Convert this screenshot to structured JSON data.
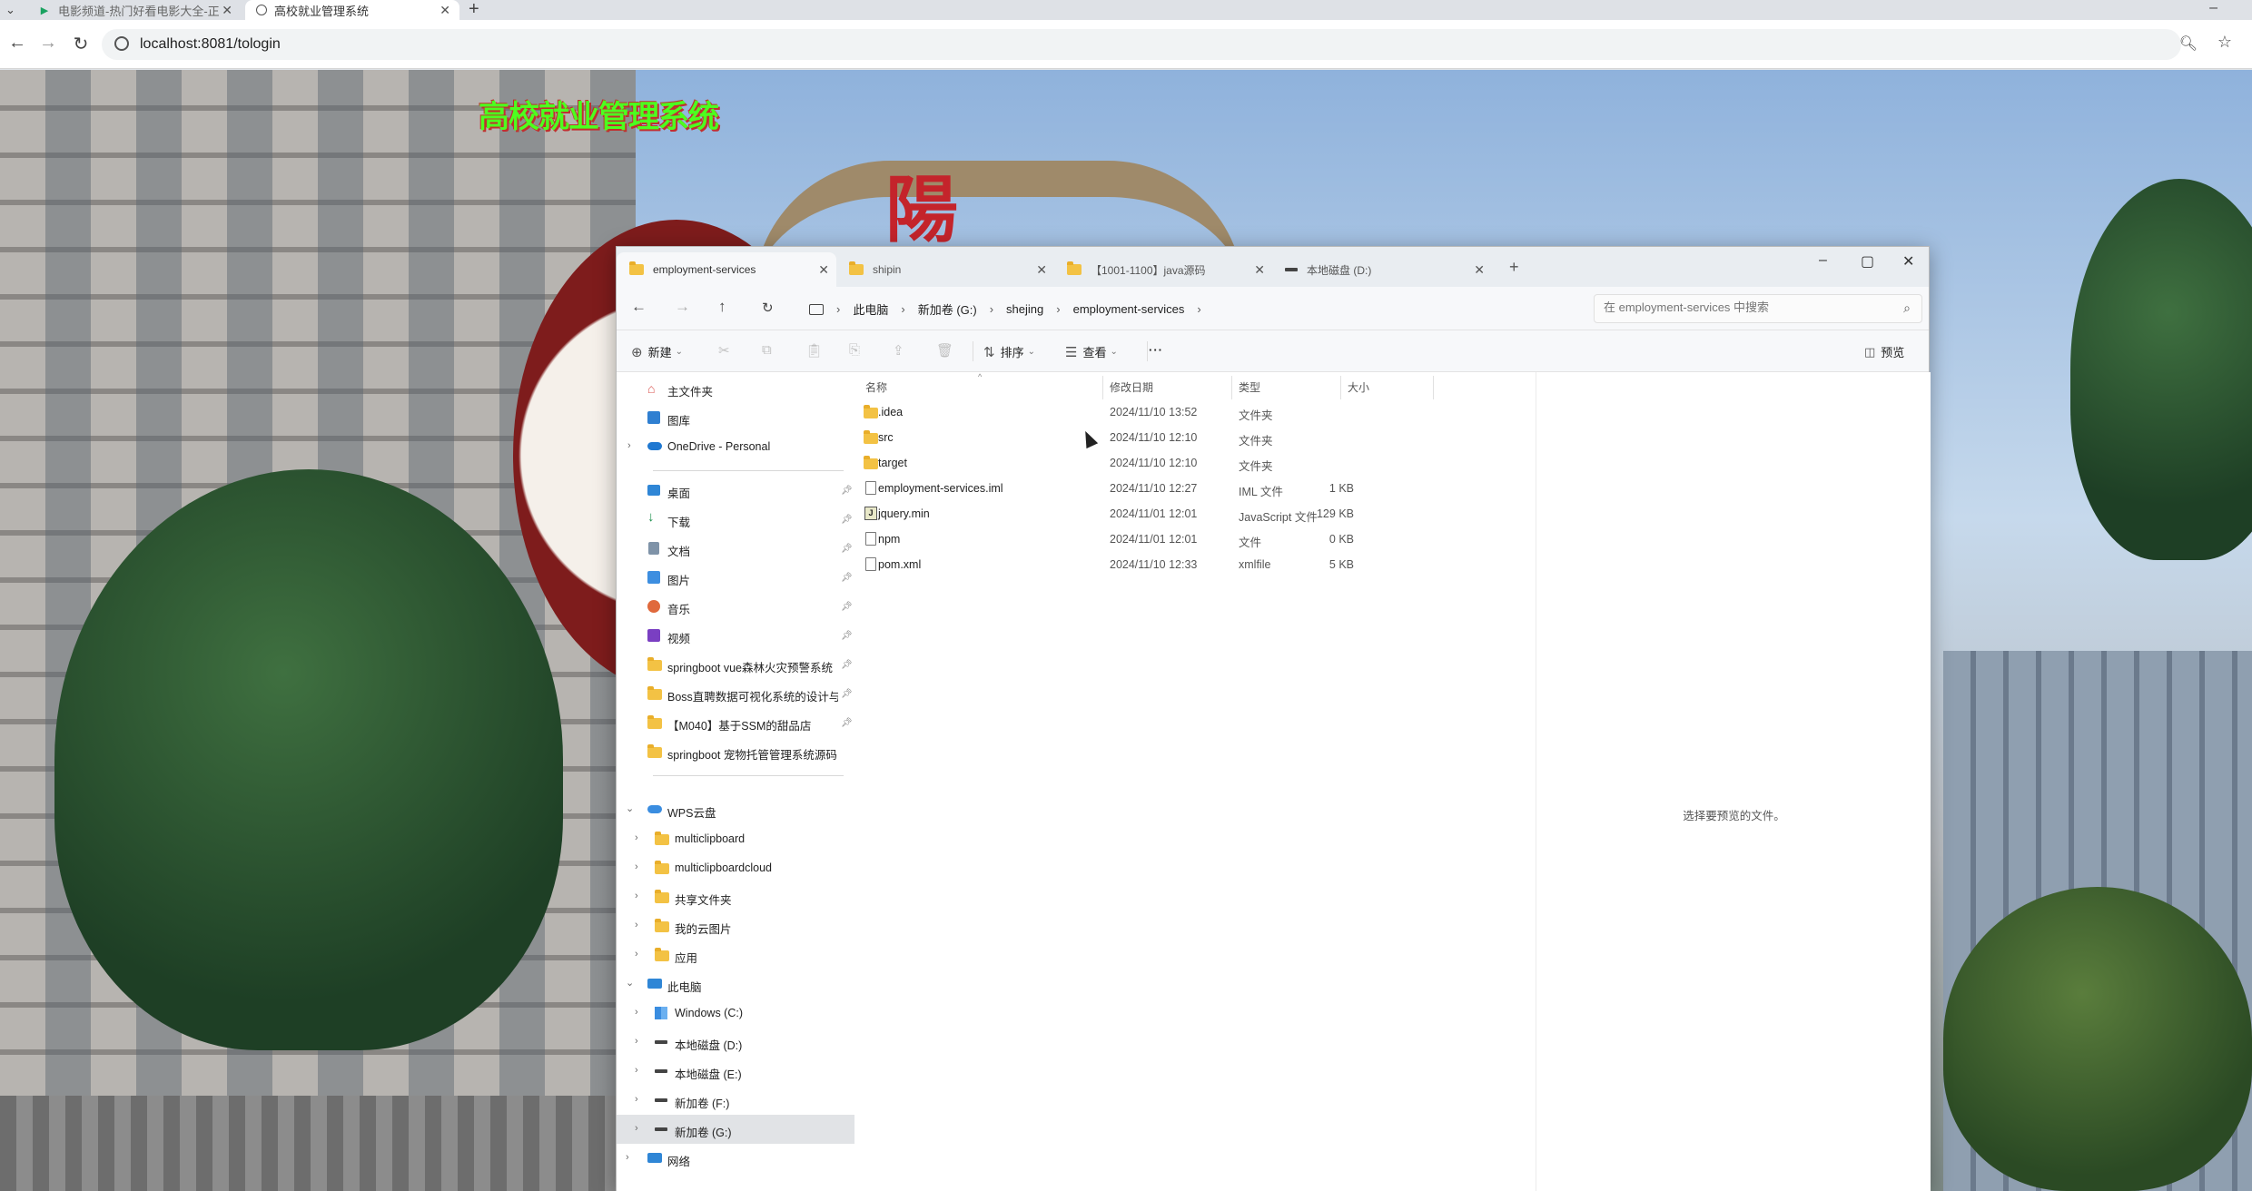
{
  "browser": {
    "tabs": [
      {
        "title": "电影频道-热门好看电影大全-正",
        "active": false
      },
      {
        "title": "高校就业管理系统",
        "active": true
      }
    ],
    "url": "localhost:8081/tologin"
  },
  "page": {
    "site_title": "高校就业管理系统"
  },
  "explorer": {
    "tabs": [
      {
        "title": "employment-services",
        "active": true,
        "icon": "folder-icon"
      },
      {
        "title": "shipin",
        "active": false,
        "icon": "folder-icon"
      },
      {
        "title": "【1001-1100】java源码",
        "active": false,
        "icon": "folder-icon"
      },
      {
        "title": "本地磁盘 (D:)",
        "active": false,
        "icon": "drive-icon"
      }
    ],
    "breadcrumb": [
      "此电脑",
      "新加卷 (G:)",
      "shejing",
      "employment-services"
    ],
    "search_placeholder": "在 employment-services 中搜索",
    "toolbar": {
      "new_label": "新建",
      "sort_label": "排序",
      "view_label": "查看",
      "more_label": "···",
      "preview_label": "预览"
    },
    "sidebar": {
      "quick": [
        {
          "label": "主文件夹",
          "icon": "home-icon"
        },
        {
          "label": "图库",
          "icon": "gallery-icon"
        },
        {
          "label": "OneDrive - Personal",
          "icon": "cloud-icon"
        }
      ],
      "pinned": [
        {
          "label": "桌面",
          "icon": "desktop-icon"
        },
        {
          "label": "下载",
          "icon": "download-icon"
        },
        {
          "label": "文档",
          "icon": "document-icon"
        },
        {
          "label": "图片",
          "icon": "picture-icon"
        },
        {
          "label": "音乐",
          "icon": "music-icon"
        },
        {
          "label": "视频",
          "icon": "video-icon"
        },
        {
          "label": "springboot vue森林火灾预警系统",
          "icon": "folder-icon"
        },
        {
          "label": "Boss直聘数据可视化系统的设计与实",
          "icon": "folder-icon"
        },
        {
          "label": "【M040】基于SSM的甜品店",
          "icon": "folder-icon"
        },
        {
          "label": "springboot 宠物托管管理系统源码",
          "icon": "folder-icon"
        }
      ],
      "wps": {
        "label": "WPS云盘",
        "children": [
          "multiclipboard",
          "multiclipboardcloud",
          "共享文件夹",
          "我的云图片",
          "应用"
        ]
      },
      "pc": {
        "label": "此电脑",
        "drives": [
          "Windows (C:)",
          "本地磁盘 (D:)",
          "本地磁盘 (E:)",
          "新加卷 (F:)",
          "新加卷 (G:)"
        ]
      },
      "network": "网络"
    },
    "columns": {
      "name": "名称",
      "date": "修改日期",
      "type": "类型",
      "size": "大小"
    },
    "files": [
      {
        "name": ".idea",
        "date": "2024/11/10 13:52",
        "type": "文件夹",
        "size": "",
        "icon": "folder-icon"
      },
      {
        "name": "src",
        "date": "2024/11/10 12:10",
        "type": "文件夹",
        "size": "",
        "icon": "folder-icon"
      },
      {
        "name": "target",
        "date": "2024/11/10 12:10",
        "type": "文件夹",
        "size": "",
        "icon": "folder-icon"
      },
      {
        "name": "employment-services.iml",
        "date": "2024/11/10 12:27",
        "type": "IML 文件",
        "size": "1 KB",
        "icon": "file-icon"
      },
      {
        "name": "jquery.min",
        "date": "2024/11/01 12:01",
        "type": "JavaScript 文件",
        "size": "129 KB",
        "icon": "js-file-icon"
      },
      {
        "name": "npm",
        "date": "2024/11/01 12:01",
        "type": "文件",
        "size": "0 KB",
        "icon": "file-icon"
      },
      {
        "name": "pom.xml",
        "date": "2024/11/10 12:33",
        "type": "xmlfile",
        "size": "5 KB",
        "icon": "file-icon"
      }
    ],
    "preview_hint": "选择要预览的文件。"
  }
}
